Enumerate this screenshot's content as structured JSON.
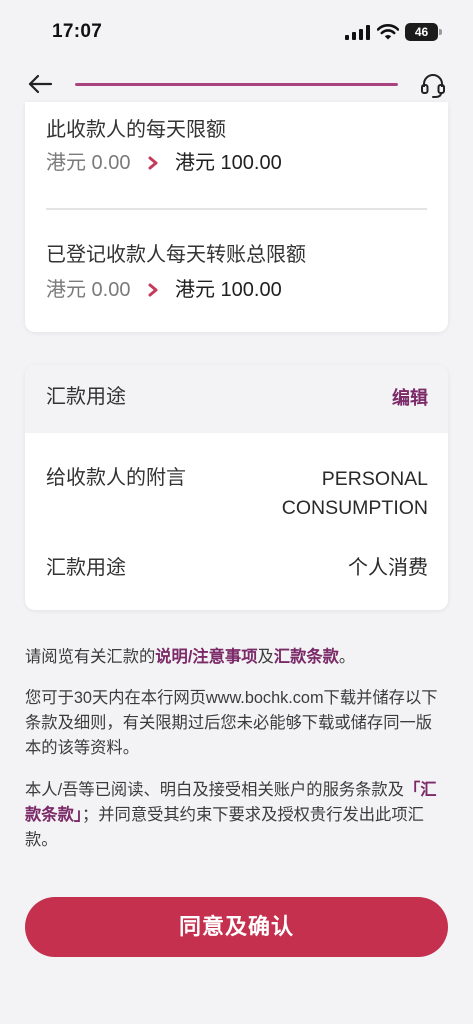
{
  "status_bar": {
    "time": "17:07",
    "battery": "46",
    "icons": [
      "signal-icon",
      "wifi-icon",
      "battery-icon"
    ]
  },
  "nav": {
    "back_icon": "arrow-left-icon",
    "support_icon": "headset-icon",
    "progress": 1.0
  },
  "limits_card": {
    "items": [
      {
        "label": "此收款人的每天限额",
        "from": "港元 0.00",
        "to": "港元 100.00"
      },
      {
        "label": "已登记收款人每天转账总限额",
        "from": "港元 0.00",
        "to": "港元 100.00"
      }
    ],
    "arrow_icon": "chevron-right-icon"
  },
  "purpose_card": {
    "title": "汇款用途",
    "edit_label": "编辑",
    "rows": [
      {
        "label": "给收款人的附言",
        "value": "PERSONAL CONSUMPTION"
      },
      {
        "label": "汇款用途",
        "value": "个人消费"
      }
    ]
  },
  "notices": {
    "p1": {
      "prefix": "请阅览有关汇款的",
      "link1": "说明/注意事项",
      "mid": "及",
      "link2": "汇款条款",
      "suffix": "。"
    },
    "p2": "您可于30天内在本行网页www.bochk.com下载并储存以下条款及细则，有关限期过后您未必能够下载或储存同一版本的该等资料。",
    "p3": {
      "prefix": "本人/吾等已阅读、明白及接受相关账户的服务条款及",
      "link": "「汇款条款」",
      "suffix": "；并同意受其约束下要求及授权贵行发出此项汇款。"
    }
  },
  "confirm_button": "同意及确认",
  "colors": {
    "accent": "#7b2a68",
    "chevron": "#c63a5c",
    "button": "#c4304e",
    "progress": "#a8437f",
    "background": "#f3f3f5"
  }
}
